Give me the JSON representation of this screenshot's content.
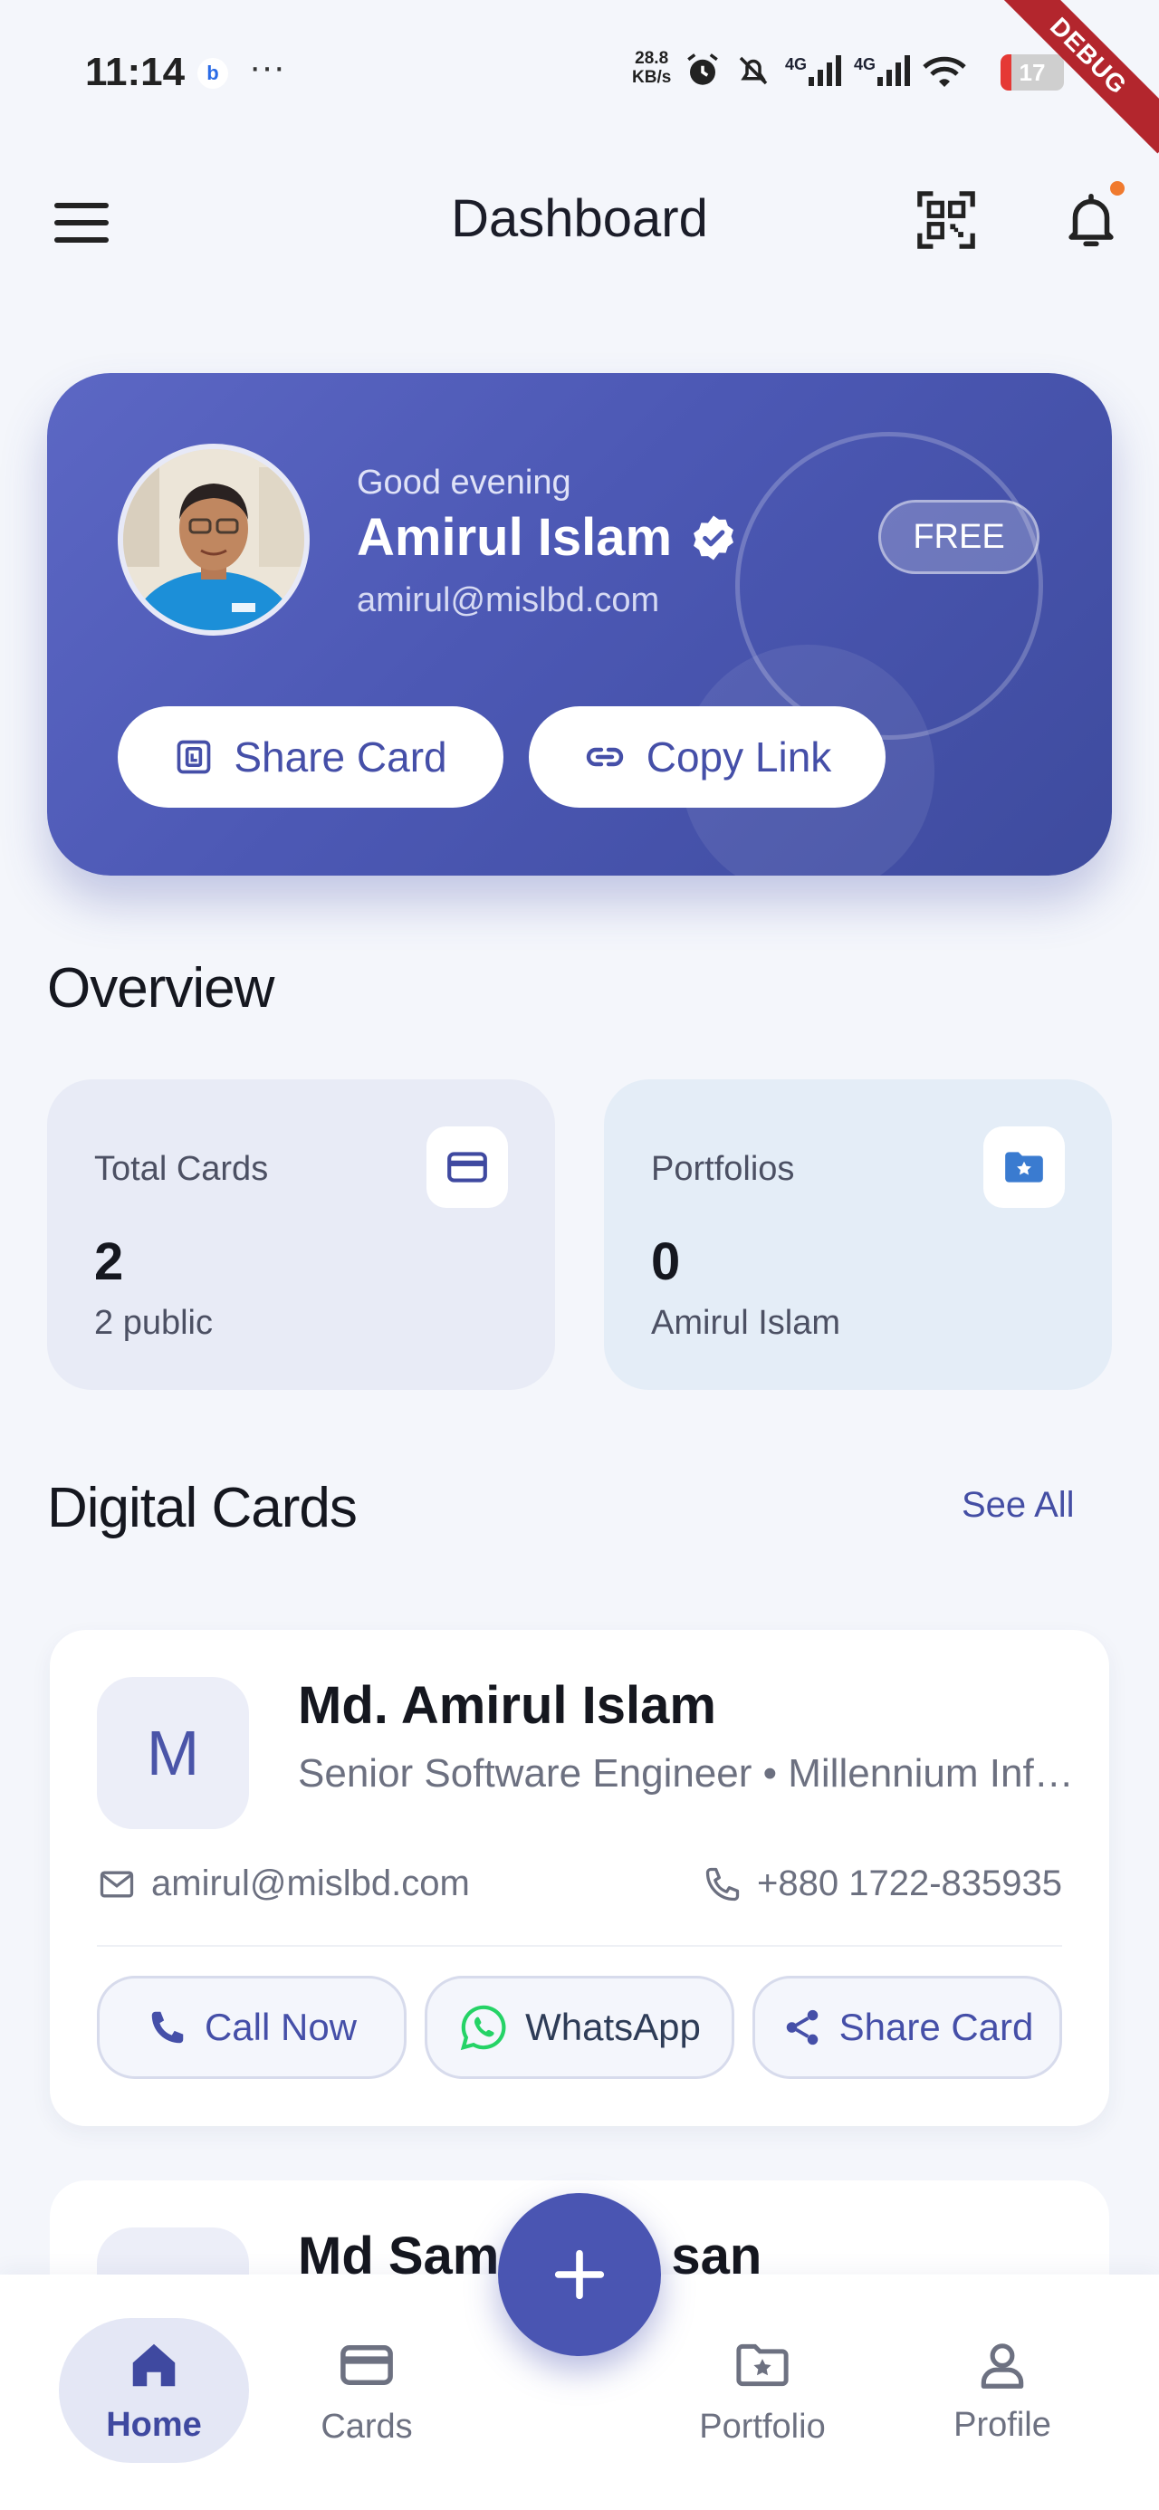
{
  "status_bar": {
    "time": "11:14",
    "app_badge": "b",
    "more": "···",
    "speed": "28.8",
    "speed_unit": "KB/s",
    "network_1": "4G",
    "network_2": "4G",
    "battery": "17",
    "debug_banner": "DEBUG"
  },
  "app_bar": {
    "title": "Dashboard",
    "menu_icon": "menu-icon",
    "qr_icon": "qr-code-icon",
    "bell_icon": "bell-icon",
    "has_notification": true
  },
  "hero": {
    "greeting": "Good evening",
    "name": "Amirul Islam",
    "email": "amirul@mislbd.com",
    "plan": "FREE",
    "share_label": "Share Card",
    "copy_label": "Copy Link"
  },
  "overview": {
    "title": "Overview",
    "stats": [
      {
        "label": "Total Cards",
        "value": "2",
        "sub": "2 public",
        "icon": "credit-card-icon"
      },
      {
        "label": "Portfolios",
        "value": "0",
        "sub": "Amirul Islam",
        "icon": "folder-star-icon"
      }
    ]
  },
  "digital_cards": {
    "title": "Digital Cards",
    "see_all": "See All",
    "cards": [
      {
        "initial": "M",
        "name": "Md. Amirul Islam",
        "role": "Senior Software Engineer • Millennium Information Solution Ltd.",
        "email": "amirul@mislbd.com",
        "phone": "+880 1722-835935",
        "actions": [
          "Call Now",
          "WhatsApp",
          "Share Card"
        ]
      },
      {
        "name": "Md Sam",
        "name_tail": "san"
      }
    ]
  },
  "bottom_nav": {
    "items": [
      {
        "label": "Home",
        "icon": "home-icon",
        "active": true
      },
      {
        "label": "Cards",
        "icon": "credit-card-icon",
        "active": false
      },
      {
        "label": "Portfolio",
        "icon": "folder-star-icon",
        "active": false
      },
      {
        "label": "Profile",
        "icon": "person-icon",
        "active": false
      }
    ],
    "fab_icon": "plus-icon"
  },
  "colors": {
    "primary": "#4a55b2",
    "background": "#f4f6fb",
    "whatsapp": "#25d366",
    "notification_dot": "#f07a2e"
  }
}
